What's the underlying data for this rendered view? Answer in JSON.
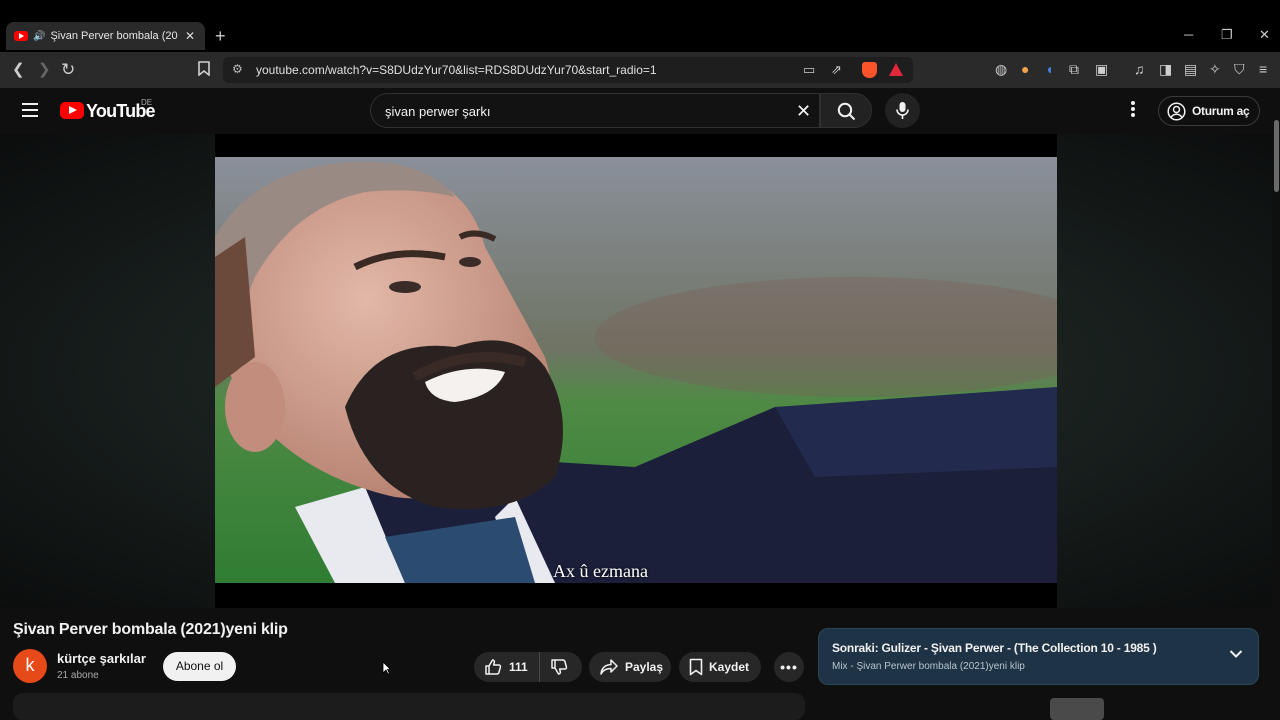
{
  "browser": {
    "tab_title": "Şivan Perver bombala (2021)y",
    "tab_audio_icon": "speaker-icon",
    "url": "youtube.com/watch?v=S8DUdzYur70&list=RDS8DUdzYur70&start_radio=1",
    "new_tab_icon": "plus-icon",
    "close_tab_icon": "close-icon"
  },
  "youtube": {
    "wordmark": "YouTube",
    "region": "DE",
    "search_query": "şivan perwer şarkı",
    "signin_label": "Oturum aç",
    "brand_color": "#ff0000"
  },
  "video": {
    "subtitle": "Ax û ezmana",
    "title": "Şivan Perver bombala (2021)yeni klip",
    "channel_initial": "k",
    "channel_name": "kürtçe şarkılar",
    "subscribers": "21 abone",
    "subscribe_label": "Abone ol",
    "likes": "111",
    "share_label": "Paylaş",
    "save_label": "Kaydet",
    "more_label": "•••"
  },
  "up_next": {
    "title": "Sonraki: Gulizer - Şivan Perwer - (The Collection 10 - 1985 )",
    "subtitle": "Mix - Şivan Perwer bombala (2021)yeni klip",
    "card_color": "#1e3446"
  }
}
